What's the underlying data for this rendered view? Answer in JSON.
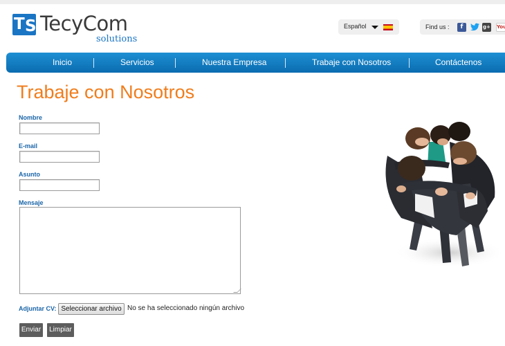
{
  "brand": {
    "logo_mark_t": "T",
    "logo_mark_s": "S",
    "name": "TecyCom",
    "subtitle": "solutions",
    "color": "#1a75c4"
  },
  "language": {
    "selected": "Español",
    "flag_icon": "spain-flag-icon"
  },
  "social": {
    "label": "Find us :",
    "icons": [
      "facebook-icon",
      "twitter-icon",
      "google-plus-icon",
      "youtube-icon"
    ],
    "facebook_glyph": "f",
    "twitter_glyph": "🐦",
    "googleplus_glyph": "g+",
    "youtube_glyph": "You"
  },
  "nav": {
    "items": [
      {
        "label": "Inicio"
      },
      {
        "label": "Servicios"
      },
      {
        "label": "Nuestra Empresa"
      },
      {
        "label": "Trabaje con Nosotros"
      },
      {
        "label": "Contáctenos"
      }
    ],
    "color": "#1580c8"
  },
  "page": {
    "title": "Trabaje con Nosotros",
    "title_color": "#f07d1c"
  },
  "form": {
    "nombre_label": "Nombre",
    "nombre_value": "",
    "email_label": "E-mail",
    "email_value": "",
    "asunto_label": "Asunto",
    "asunto_value": "",
    "mensaje_label": "Mensaje",
    "mensaje_value": "",
    "cv_label": "Adjuntar CV:",
    "file_button": "Seleccionar archivo",
    "file_status": "No se ha seleccionado ningún archivo",
    "submit_label": "Enviar",
    "reset_label": "Limpiar",
    "label_color": "#1a65a8"
  }
}
